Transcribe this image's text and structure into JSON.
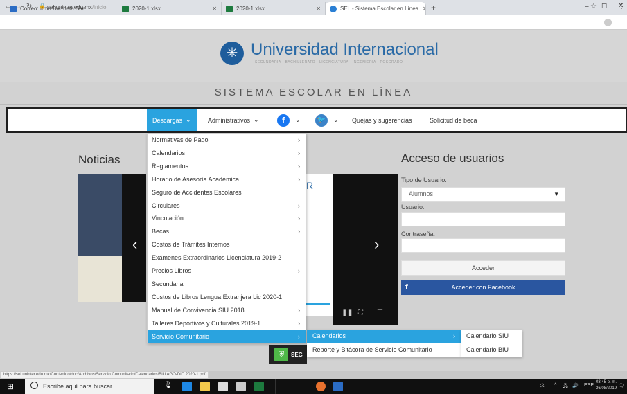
{
  "browser": {
    "tabs": [
      {
        "title": "Correo: Irma Barroeta Sanchez - ",
        "color": "#2b6cc4"
      },
      {
        "title": "2020-1.xlsx",
        "color": "#1d7a3e"
      },
      {
        "title": "2020-1.xlsx",
        "color": "#1d7a3e"
      },
      {
        "title": "SEL - Sistema Escolar en Línea",
        "color": "#2a7fd4"
      }
    ],
    "url_host": "sel.uninter.edu.mx",
    "url_path": "/inicio",
    "status_url": "https://sel.uninter.edu.mx/Contenido/doc/Archivos/Servicio Comunitario/Calendarios/BIU AGO-DIC 2020-1.pdf"
  },
  "site": {
    "logo_title": "Universidad Internacional",
    "logo_subtitle": "SECUNDARIA · BACHILLERATO · LICENCIATURA · INGENIERÍA · POSGRADO",
    "system_title": "SISTEMA ESCOLAR EN LÍNEA",
    "menu": {
      "descargas": "Descargas",
      "administrativos": "Administrativos",
      "quejas": "Quejas y sugerencias",
      "beca": "Solicitud de beca"
    },
    "noticias": "Noticias",
    "poster_text": "SEG",
    "poster_letter": "R"
  },
  "dropdown": {
    "items": [
      {
        "label": "Normativas de Pago",
        "arrow": true
      },
      {
        "label": "Calendarios",
        "arrow": true
      },
      {
        "label": "Reglamentos",
        "arrow": true
      },
      {
        "label": "Horario de Asesoría Académica",
        "arrow": true
      },
      {
        "label": "Seguro de Accidentes Escolares",
        "arrow": false
      },
      {
        "label": "Circulares",
        "arrow": true
      },
      {
        "label": "Vinculación",
        "arrow": true
      },
      {
        "label": "Becas",
        "arrow": true
      },
      {
        "label": "Costos de Trámites Internos",
        "arrow": false
      },
      {
        "label": "Exámenes Extraordinarios Licenciatura 2019-2",
        "arrow": false
      },
      {
        "label": "Precios Libros",
        "arrow": true
      },
      {
        "label": "Secundaria",
        "arrow": false
      },
      {
        "label": "Costos de Libros Lengua Extranjera Lic 2020-1",
        "arrow": false
      },
      {
        "label": "Manual de Convivencia SIU 2018",
        "arrow": true
      },
      {
        "label": "Talleres Deportivos y Culturales 2019-1",
        "arrow": true
      },
      {
        "label": "Servicio Comunitario",
        "arrow": true
      }
    ],
    "sub1": [
      "Calendarios",
      "Reporte y Bitácora de Servicio Comunitario"
    ],
    "sub2": [
      "Calendario SIU",
      "Calendario BIU"
    ]
  },
  "access": {
    "title": "Acceso de usuarios",
    "tipo_label": "Tipo de Usuario:",
    "tipo_value": "Alumnos",
    "usuario_label": "Usuario:",
    "password_label": "Contraseña:",
    "acceder": "Acceder",
    "facebook": "Acceder con Facebook"
  },
  "taskbar": {
    "search_placeholder": "Escribe aquí para buscar",
    "lang": "ESP",
    "time": "03:45 p. m.",
    "date": "26/08/2019"
  },
  "colors": {
    "accent": "#2aa3df",
    "facebook": "#2a56a0"
  }
}
